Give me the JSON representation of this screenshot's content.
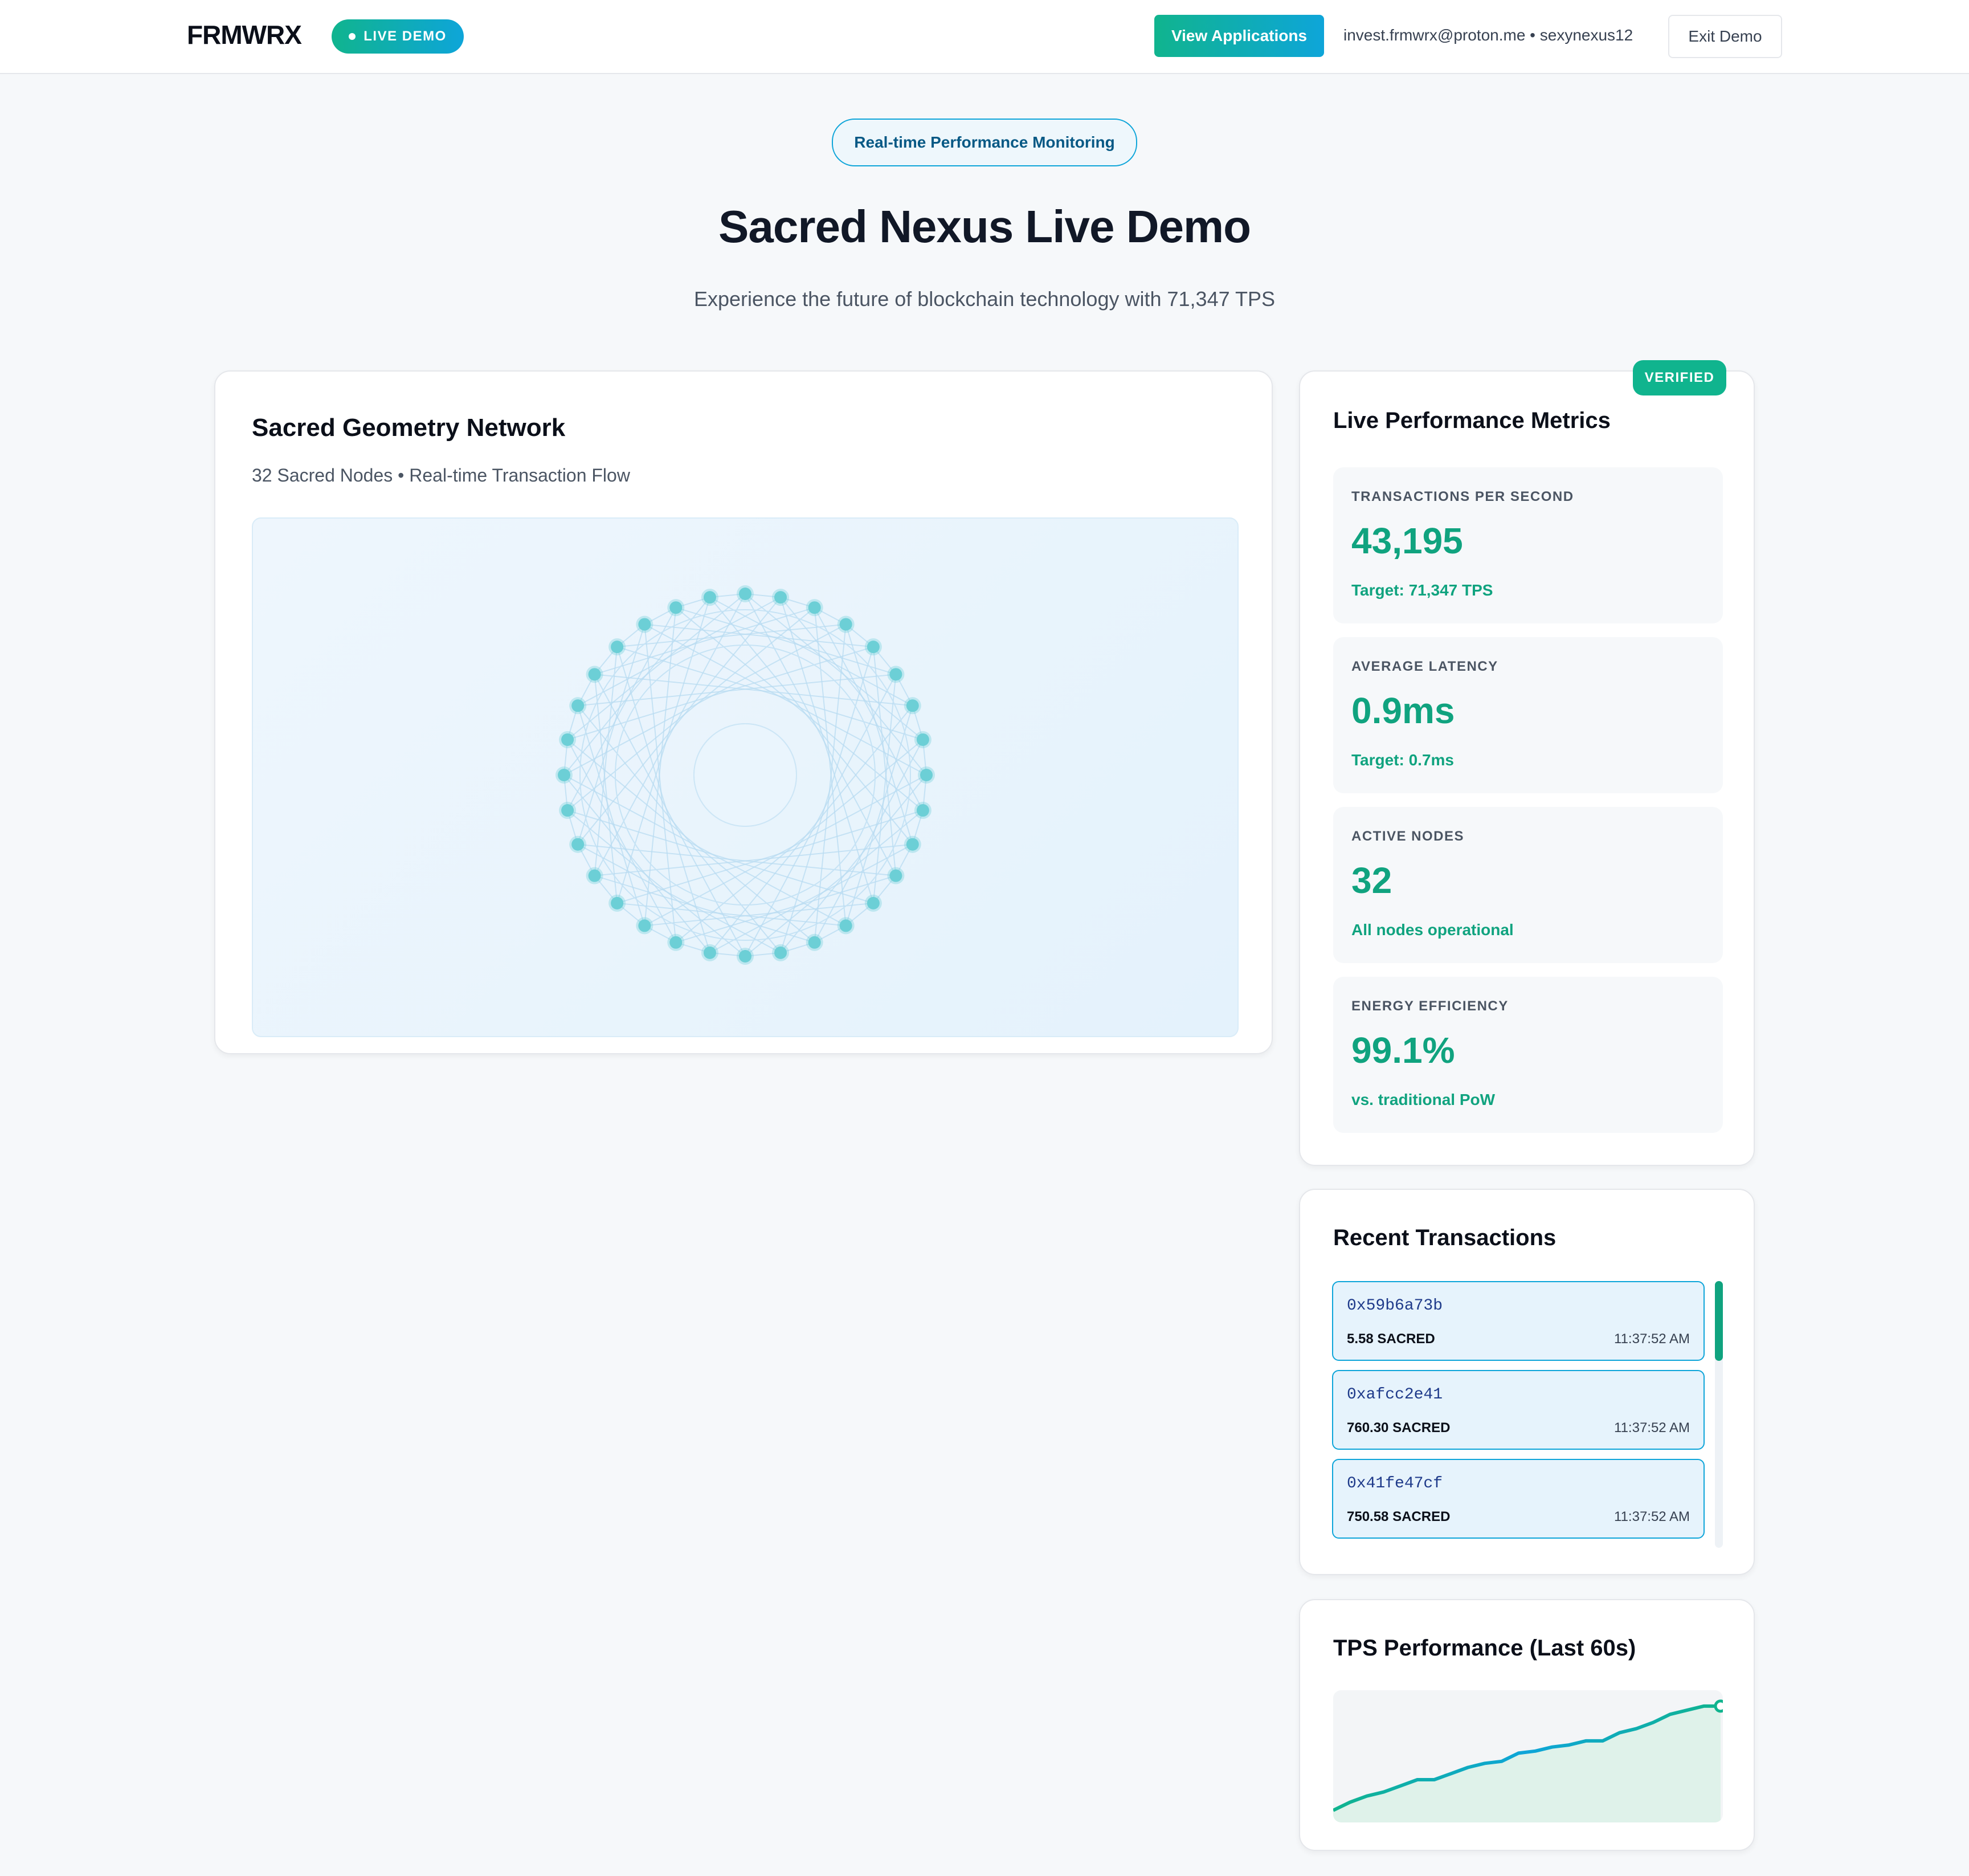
{
  "header": {
    "logo": "FRMWRX",
    "live_badge": "LIVE DEMO",
    "view_applications": "View Applications",
    "user_info": "invest.frmwrx@proton.me • sexynexus12",
    "exit_demo": "Exit Demo"
  },
  "hero": {
    "pill": "Real-time Performance Monitoring",
    "title": "Sacred Nexus Live Demo",
    "subtitle": "Experience the future of blockchain technology with 71,347 TPS"
  },
  "network": {
    "title": "Sacred Geometry Network",
    "subtitle": "32 Sacred Nodes • Real-time Transaction Flow",
    "node_count": 32,
    "node_color": "#6ccfd6"
  },
  "metrics": {
    "badge": "VERIFIED",
    "title": "Live Performance Metrics",
    "items": [
      {
        "label": "TRANSACTIONS PER SECOND",
        "value": "43,195",
        "note": "Target: 71,347 TPS"
      },
      {
        "label": "AVERAGE LATENCY",
        "value": "0.9ms",
        "note": "Target: 0.7ms"
      },
      {
        "label": "ACTIVE NODES",
        "value": "32",
        "note": "All nodes operational"
      },
      {
        "label": "ENERGY EFFICIENCY",
        "value": "99.1%",
        "note": "vs. traditional PoW"
      }
    ]
  },
  "transactions": {
    "title": "Recent Transactions",
    "items": [
      {
        "hash": "0x59b6a73b",
        "amount": "5.58 SACRED",
        "time": "11:37:52 AM"
      },
      {
        "hash": "0xafcc2e41",
        "amount": "760.30 SACRED",
        "time": "11:37:52 AM"
      },
      {
        "hash": "0x41fe47cf",
        "amount": "750.58 SACRED",
        "time": "11:37:52 AM"
      }
    ]
  },
  "tps_chart": {
    "title": "TPS Performance (Last 60s)"
  },
  "chart_data": {
    "type": "area",
    "title": "TPS Performance (Last 60s)",
    "xlabel": "",
    "ylabel": "",
    "grid": false,
    "values": [
      2,
      6,
      9,
      11,
      14,
      17,
      17,
      20,
      23,
      25,
      26,
      30,
      31,
      33,
      34,
      36,
      36,
      40,
      42,
      45,
      49,
      51,
      53,
      53
    ],
    "line_colors": [
      "#10b48e",
      "#0ea5d9"
    ],
    "fill_color": "#dff2ea"
  },
  "colors": {
    "accent_green": "#10a37f",
    "accent_blue": "#0ea5d9"
  }
}
